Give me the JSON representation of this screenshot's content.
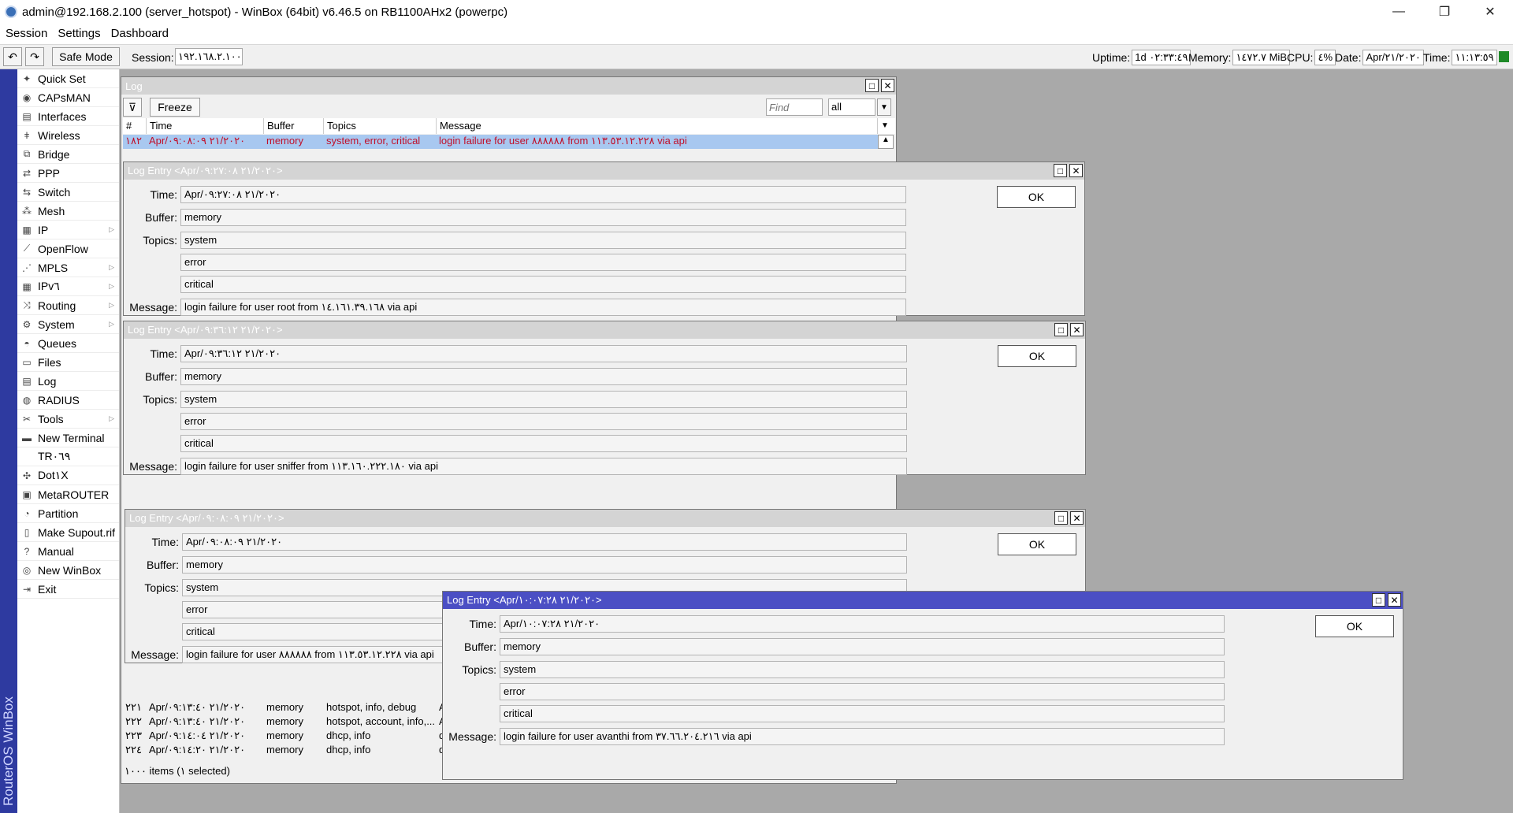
{
  "window": {
    "title": "admin@192.168.2.100 (server_hotspot) - WinBox (64bit) v6.46.5 on RB1100AHx2 (powerpc)",
    "controls": {
      "minimize": "—",
      "restore": "❐",
      "close": "✕"
    }
  },
  "menu": [
    "Session",
    "Settings",
    "Dashboard"
  ],
  "toolbar": {
    "undo_icon": "↶",
    "redo_icon": "↷",
    "safe_mode": "Safe Mode",
    "session_label": "Session:",
    "session_value": "١٩٢.١٦٨.٢.١٠٠",
    "uptime_label": "Uptime:",
    "uptime_value": "1d ٠٢:٣٣:٤٩",
    "memory_label": "Memory:",
    "memory_value": "١٤٧٢.٧ MiB",
    "cpu_label": "CPU:",
    "cpu_value": "٤%",
    "date_label": "Date:",
    "date_value": "Apr/٢١/٢٠٢٠",
    "time_label": "Time:",
    "time_value": "١١:١٣:٥٩",
    "status_color": "#1f8a28"
  },
  "vertical_brand": "RouterOS WinBox",
  "sidebar": [
    {
      "label": "Quick Set",
      "icon": "wand-icon",
      "arrow": false
    },
    {
      "label": "CAPsMAN",
      "icon": "caps-icon",
      "arrow": false
    },
    {
      "label": "Interfaces",
      "icon": "interfaces-icon",
      "arrow": false
    },
    {
      "label": "Wireless",
      "icon": "wireless-icon",
      "arrow": false
    },
    {
      "label": "Bridge",
      "icon": "bridge-icon",
      "arrow": false
    },
    {
      "label": "PPP",
      "icon": "ppp-icon",
      "arrow": false
    },
    {
      "label": "Switch",
      "icon": "switch-icon",
      "arrow": false
    },
    {
      "label": "Mesh",
      "icon": "mesh-icon",
      "arrow": false
    },
    {
      "label": "IP",
      "icon": "ip-icon",
      "arrow": true
    },
    {
      "label": "OpenFlow",
      "icon": "openflow-icon",
      "arrow": false
    },
    {
      "label": "MPLS",
      "icon": "mpls-icon",
      "arrow": true
    },
    {
      "label": "IPv٦",
      "icon": "ipv6-icon",
      "arrow": true
    },
    {
      "label": "Routing",
      "icon": "routing-icon",
      "arrow": true
    },
    {
      "label": "System",
      "icon": "gear-icon",
      "arrow": true
    },
    {
      "label": "Queues",
      "icon": "queues-icon",
      "arrow": false
    },
    {
      "label": "Files",
      "icon": "files-icon",
      "arrow": false
    },
    {
      "label": "Log",
      "icon": "log-icon",
      "arrow": false
    },
    {
      "label": "RADIUS",
      "icon": "radius-icon",
      "arrow": false
    },
    {
      "label": "Tools",
      "icon": "tools-icon",
      "arrow": true
    },
    {
      "label": "New Terminal",
      "icon": "terminal-icon",
      "arrow": false
    },
    {
      "label": "TR٠٦٩",
      "icon": "",
      "arrow": false
    },
    {
      "label": "Dot١X",
      "icon": "dot1x-icon",
      "arrow": false
    },
    {
      "label": "MetaROUTER",
      "icon": "metarouter-icon",
      "arrow": false
    },
    {
      "label": "Partition",
      "icon": "partition-icon",
      "arrow": false
    },
    {
      "label": "Make Supout.rif",
      "icon": "supout-icon",
      "arrow": false
    },
    {
      "label": "Manual",
      "icon": "help-icon",
      "arrow": false
    },
    {
      "label": "New WinBox",
      "icon": "winbox-icon",
      "arrow": false
    },
    {
      "label": "Exit",
      "icon": "exit-icon",
      "arrow": false
    }
  ],
  "log_window": {
    "title": "Log",
    "freeze": "Freeze",
    "find_placeholder": "Find",
    "filter_value": "all",
    "columns": [
      "#",
      "Time",
      "Buffer",
      "Topics",
      "Message"
    ],
    "selected_row": {
      "num": "١٨٢",
      "time": "Apr/٢١/٢٠٢٠ ٠٩:٠٨:٠٩",
      "buffer": "memory",
      "topics": "system, error, critical",
      "message": "login failure for user ٨٨٨٨٨٨ from ١١٣.٥٣.١٢.٢٢٨ via api"
    },
    "rows": [
      {
        "num": "٢٢١",
        "time": "Apr/٢١/٢٠٢٠ ٠٩:١٣:٤٠",
        "buffer": "memory",
        "topics": "hotspot, info, debug",
        "message": "A"
      },
      {
        "num": "٢٢٢",
        "time": "Apr/٢١/٢٠٢٠ ٠٩:١٣:٤٠",
        "buffer": "memory",
        "topics": "hotspot, account, info,...",
        "message": "A"
      },
      {
        "num": "٢٢٣",
        "time": "Apr/٢١/٢٠٢٠ ٠٩:١٤:٠٤",
        "buffer": "memory",
        "topics": "dhcp, info",
        "message": "d"
      },
      {
        "num": "٢٢٤",
        "time": "Apr/٢١/٢٠٢٠ ٠٩:١٤:٢٠",
        "buffer": "memory",
        "topics": "dhcp, info",
        "message": "d"
      }
    ],
    "status": "١٠٠٠ items (١ selected)"
  },
  "entries": [
    {
      "title": "Log Entry <Apr/٢١/٢٠٢٠ ٠٩:٢٧:٠٨>",
      "time": "Apr/٢١/٢٠٢٠ ٠٩:٢٧:٠٨",
      "buffer": "memory",
      "topics": [
        "system",
        "error",
        "critical"
      ],
      "message": "login failure for user root from ١٤.١٦١.٣٩.١٦٨ via api"
    },
    {
      "title": "Log Entry <Apr/٢١/٢٠٢٠ ٠٩:٣٦:١٢>",
      "time": "Apr/٢١/٢٠٢٠ ٠٩:٣٦:١٢",
      "buffer": "memory",
      "topics": [
        "system",
        "error",
        "critical"
      ],
      "message": "login failure for user sniffer from ١١٣.١٦٠.٢٢٢.١٨٠ via api"
    },
    {
      "title": "Log Entry <Apr/٢١/٢٠٢٠ ٠٩:٠٨:٠٩>",
      "time": "Apr/٢١/٢٠٢٠ ٠٩:٠٨:٠٩",
      "buffer": "memory",
      "topics": [
        "system",
        "error",
        "critical"
      ],
      "message": "login failure for user ٨٨٨٨٨٨ from ١١٣.٥٣.١٢.٢٢٨ via api"
    },
    {
      "title": "Log Entry <Apr/٢١/٢٠٢٠ ١٠:٠٧:٢٨>",
      "time": "Apr/٢١/٢٠٢٠ ١٠:٠٧:٢٨",
      "buffer": "memory",
      "topics": [
        "system",
        "error",
        "critical"
      ],
      "message": "login failure for user avanthi from ٣٧.٦٦.٢٠٤.٢١٦ via api"
    }
  ],
  "labels": {
    "time": "Time:",
    "buffer": "Buffer:",
    "topics": "Topics:",
    "message": "Message:",
    "ok": "OK"
  },
  "colors": {
    "active_title": "#4b4fc4",
    "selected_row_bg": "#a8c8f0",
    "error_text": "#c0102a"
  }
}
